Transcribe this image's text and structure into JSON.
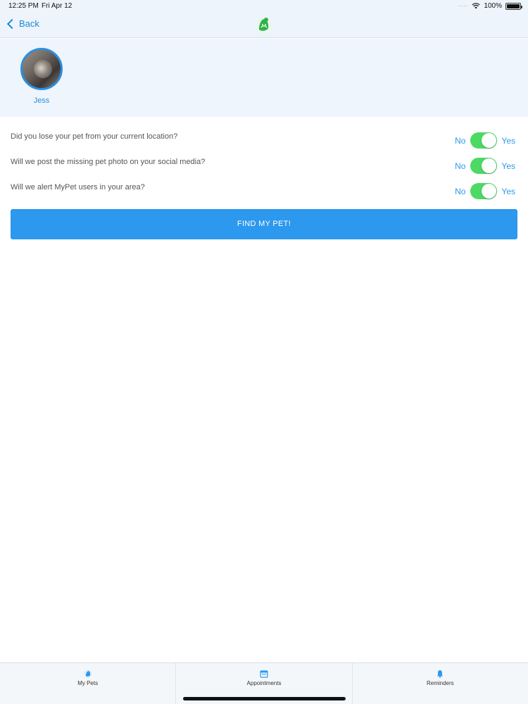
{
  "status": {
    "time": "12:25 PM",
    "date": "Fri Apr 12",
    "battery": "100%",
    "battery_level": 1.0
  },
  "nav": {
    "back_label": "Back",
    "logo_icon": "mypet-logo-icon"
  },
  "profile": {
    "pet_name": "Jess"
  },
  "questions": [
    {
      "text": "Did you lose your pet from your current location?",
      "no_label": "No",
      "yes_label": "Yes",
      "value": true
    },
    {
      "text": "Will we post the missing pet photo on your social media?",
      "no_label": "No",
      "yes_label": "Yes",
      "value": true
    },
    {
      "text": "Will we alert MyPet users in your area?",
      "no_label": "No",
      "yes_label": "Yes",
      "value": true
    }
  ],
  "find_button": {
    "label": "FIND MY PET!"
  },
  "tabs": [
    {
      "label": "My Pets",
      "icon": "pet-icon"
    },
    {
      "label": "Appointments",
      "icon": "calendar-icon"
    },
    {
      "label": "Reminders",
      "icon": "bell-icon"
    }
  ],
  "colors": {
    "accent": "#2c98ee",
    "toggle_on": "#4cd964",
    "header_bg": "#eef4fb"
  }
}
